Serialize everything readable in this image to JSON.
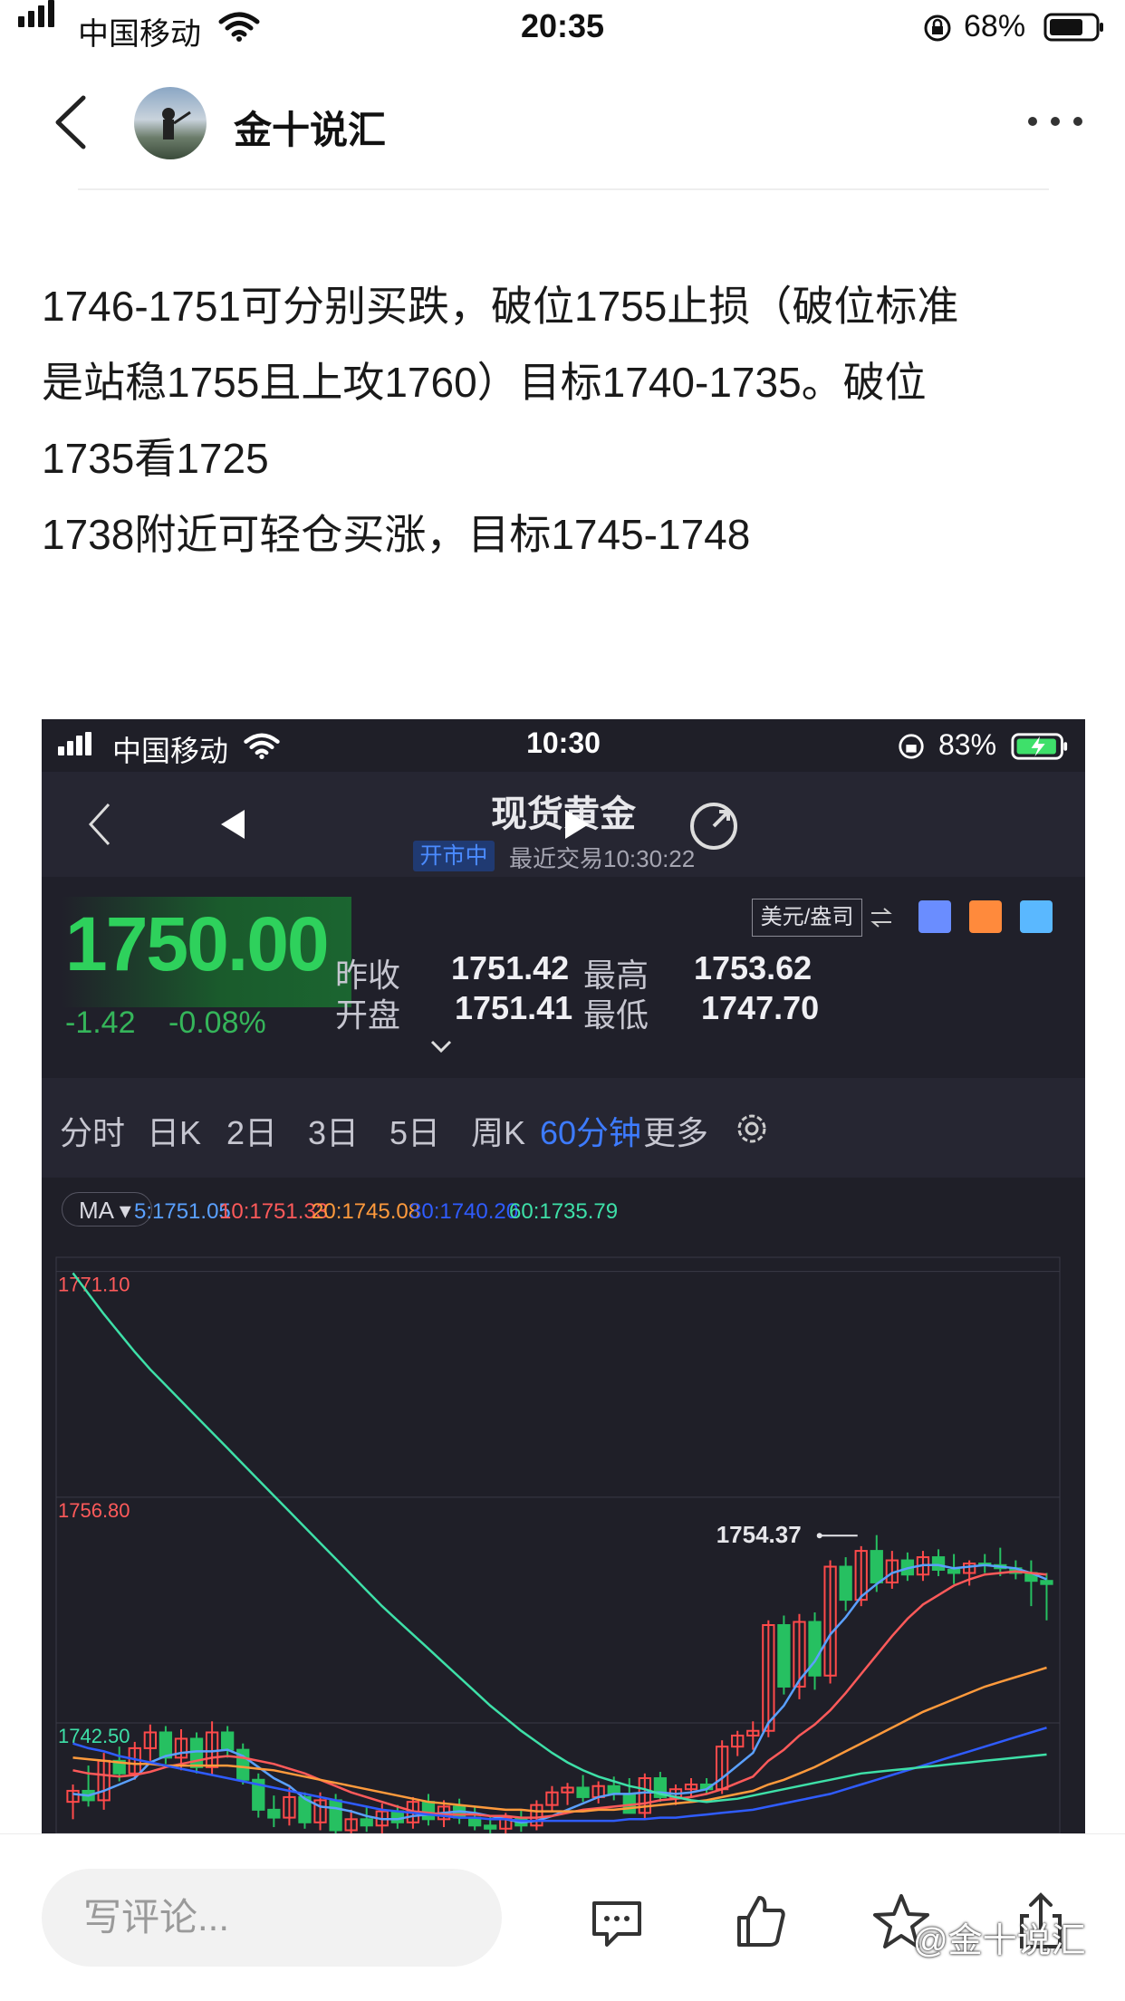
{
  "status_bar": {
    "carrier": "中国移动",
    "time": "20:35",
    "battery": "68%"
  },
  "header": {
    "author": "金十说汇"
  },
  "post": {
    "lines": [
      "1746-1751可分别买跌，破位1755止损（破位标准",
      "是站稳1755且上攻1760）目标1740-1735。破位",
      "1735看1725",
      "1738附近可轻仓买涨，目标1745-1748"
    ]
  },
  "screenshot": {
    "status_bar": {
      "carrier": "中国移动",
      "time": "10:30",
      "battery": "83%"
    },
    "nav": {
      "title": "现货黄金",
      "status_badge": "开市中",
      "recent_trade": "最近交易10:30:22"
    },
    "quote": {
      "price": "1750.00",
      "change": "-1.42",
      "change_pct": "-0.08%",
      "unit_label": "美元/盎司",
      "prev_close_label": "昨收",
      "prev_close": "1751.42",
      "open_label": "开盘",
      "open": "1751.41",
      "high_label": "最高",
      "high": "1753.62",
      "low_label": "最低",
      "low": "1747.70"
    },
    "tabs": [
      "分时",
      "日K",
      "2日",
      "3日",
      "5日",
      "周K",
      "60分钟",
      "更多"
    ],
    "active_tab": "60分钟",
    "ma_bar": {
      "button": "MA",
      "values": [
        {
          "label": "5:1751.05",
          "color": "#5aa0ff"
        },
        {
          "label": "10:1751.33",
          "color": "#ff5a5a"
        },
        {
          "label": "20:1745.08",
          "color": "#ff9a3c"
        },
        {
          "label": "30:1740.20",
          "color": "#2f5cff"
        },
        {
          "label": "60:1735.79",
          "color": "#3ee0a8"
        }
      ]
    },
    "colors": {
      "up": "#ff4a4a",
      "down": "#26c061",
      "accent": "#3d7bff"
    }
  },
  "chart_data": {
    "type": "candlestick",
    "y_tick_labels": [
      "1771.10",
      "1756.80",
      "1742.50"
    ],
    "ylim": [
      1735.5,
      1772.0
    ],
    "annotation": {
      "label": "1754.37",
      "value": 1754.37
    },
    "candles": [
      [
        1737.5,
        1738.6,
        1736.4,
        1738.2
      ],
      [
        1738.2,
        1739.8,
        1737.2,
        1737.6
      ],
      [
        1737.6,
        1740.6,
        1737.0,
        1740.1
      ],
      [
        1740.1,
        1741.0,
        1738.8,
        1739.3
      ],
      [
        1739.3,
        1741.3,
        1738.9,
        1740.9
      ],
      [
        1740.9,
        1742.4,
        1740.1,
        1741.9
      ],
      [
        1741.9,
        1742.3,
        1739.9,
        1740.3
      ],
      [
        1740.3,
        1742.1,
        1739.5,
        1741.5
      ],
      [
        1741.5,
        1741.9,
        1739.3,
        1739.7
      ],
      [
        1739.7,
        1742.6,
        1739.2,
        1741.9
      ],
      [
        1741.9,
        1742.3,
        1740.3,
        1740.8
      ],
      [
        1740.8,
        1741.2,
        1738.6,
        1738.9
      ],
      [
        1738.9,
        1739.3,
        1736.5,
        1737.0
      ],
      [
        1737.0,
        1737.9,
        1735.9,
        1736.5
      ],
      [
        1736.5,
        1738.4,
        1736.0,
        1737.8
      ],
      [
        1737.8,
        1738.1,
        1735.8,
        1736.2
      ],
      [
        1736.2,
        1738.1,
        1735.7,
        1737.6
      ],
      [
        1737.6,
        1738.0,
        1735.2,
        1735.7
      ],
      [
        1735.7,
        1737.0,
        1735.2,
        1736.4
      ],
      [
        1736.4,
        1737.2,
        1735.6,
        1736.0
      ],
      [
        1736.0,
        1737.4,
        1735.5,
        1736.9
      ],
      [
        1736.9,
        1737.3,
        1735.8,
        1736.2
      ],
      [
        1736.2,
        1737.8,
        1735.8,
        1737.5
      ],
      [
        1737.5,
        1738.0,
        1736.0,
        1736.4
      ],
      [
        1736.4,
        1737.6,
        1735.9,
        1737.2
      ],
      [
        1737.2,
        1737.7,
        1736.1,
        1736.5
      ],
      [
        1736.5,
        1737.2,
        1735.7,
        1736.0
      ],
      [
        1736.0,
        1736.6,
        1735.4,
        1735.8
      ],
      [
        1735.8,
        1736.8,
        1735.4,
        1736.5
      ],
      [
        1736.5,
        1737.0,
        1735.6,
        1736.0
      ],
      [
        1736.0,
        1737.6,
        1735.7,
        1737.3
      ],
      [
        1737.3,
        1738.5,
        1736.9,
        1738.1
      ],
      [
        1738.1,
        1738.7,
        1737.3,
        1738.4
      ],
      [
        1738.4,
        1739.2,
        1737.5,
        1737.8
      ],
      [
        1737.8,
        1738.8,
        1737.4,
        1738.5
      ],
      [
        1738.5,
        1739.1,
        1737.6,
        1738.0
      ],
      [
        1738.0,
        1739.0,
        1737.2,
        1736.8
      ],
      [
        1736.8,
        1739.3,
        1736.4,
        1739.0
      ],
      [
        1739.0,
        1739.4,
        1737.5,
        1737.8
      ],
      [
        1737.8,
        1738.6,
        1737.3,
        1738.3
      ],
      [
        1738.3,
        1739.0,
        1737.8,
        1738.6
      ],
      [
        1738.6,
        1739.0,
        1738.0,
        1738.3
      ],
      [
        1738.3,
        1741.4,
        1738.0,
        1741.0
      ],
      [
        1741.0,
        1742.0,
        1740.4,
        1741.7
      ],
      [
        1741.7,
        1742.6,
        1740.8,
        1742.0
      ],
      [
        1742.0,
        1749.0,
        1741.6,
        1748.7
      ],
      [
        1748.7,
        1749.3,
        1744.3,
        1744.8
      ],
      [
        1744.8,
        1749.4,
        1744.0,
        1748.9
      ],
      [
        1748.9,
        1749.5,
        1744.6,
        1745.5
      ],
      [
        1745.5,
        1752.8,
        1745.0,
        1752.4
      ],
      [
        1752.4,
        1753.0,
        1749.6,
        1750.3
      ],
      [
        1750.3,
        1753.7,
        1749.9,
        1753.4
      ],
      [
        1753.4,
        1754.4,
        1750.8,
        1751.4
      ],
      [
        1751.4,
        1753.4,
        1751.0,
        1752.8
      ],
      [
        1752.8,
        1753.3,
        1751.5,
        1751.9
      ],
      [
        1751.9,
        1753.4,
        1751.5,
        1753.0
      ],
      [
        1753.0,
        1753.5,
        1751.8,
        1752.2
      ],
      [
        1752.2,
        1753.2,
        1751.3,
        1752.0
      ],
      [
        1752.0,
        1752.8,
        1751.2,
        1752.6
      ],
      [
        1752.6,
        1753.2,
        1752.0,
        1752.5
      ],
      [
        1752.5,
        1753.6,
        1751.8,
        1752.3
      ],
      [
        1752.3,
        1752.8,
        1751.6,
        1752.0
      ],
      [
        1752.0,
        1752.8,
        1749.9,
        1751.5
      ],
      [
        1751.5,
        1752.0,
        1749.0,
        1751.3
      ]
    ],
    "ma_lines": [
      {
        "name": "5",
        "color": "#5aa0ff",
        "values": [
          1738.0,
          1737.9,
          1738.2,
          1738.6,
          1739.0,
          1740.0,
          1740.4,
          1740.6,
          1740.7,
          1740.7,
          1740.8,
          1740.4,
          1739.7,
          1739.0,
          1738.5,
          1737.7,
          1737.2,
          1737.1,
          1736.9,
          1736.6,
          1736.4,
          1736.4,
          1736.6,
          1736.7,
          1736.8,
          1736.9,
          1736.8,
          1736.6,
          1736.4,
          1736.2,
          1736.3,
          1736.6,
          1737.0,
          1737.4,
          1737.8,
          1738.0,
          1738.0,
          1738.1,
          1738.1,
          1738.0,
          1738.1,
          1738.3,
          1739.0,
          1739.8,
          1740.6,
          1742.5,
          1743.6,
          1745.2,
          1746.4,
          1748.1,
          1749.2,
          1750.5,
          1751.3,
          1752.0,
          1752.3,
          1752.5,
          1752.5,
          1752.3,
          1752.4,
          1752.5,
          1752.4,
          1752.3,
          1752.0,
          1751.6
        ]
      },
      {
        "name": "10",
        "color": "#ff5a5a",
        "values": [
          1739.5,
          1739.3,
          1739.2,
          1739.1,
          1739.2,
          1739.4,
          1739.7,
          1739.9,
          1740.1,
          1740.3,
          1740.4,
          1740.3,
          1740.1,
          1739.9,
          1739.6,
          1739.3,
          1738.9,
          1738.5,
          1738.1,
          1737.8,
          1737.5,
          1737.2,
          1736.9,
          1736.8,
          1736.7,
          1736.7,
          1736.7,
          1736.6,
          1736.6,
          1736.5,
          1736.5,
          1736.6,
          1736.8,
          1737.0,
          1737.1,
          1737.2,
          1737.3,
          1737.4,
          1737.6,
          1737.7,
          1737.8,
          1738.0,
          1738.3,
          1738.7,
          1739.1,
          1740.1,
          1740.8,
          1741.7,
          1742.4,
          1743.3,
          1744.4,
          1745.6,
          1746.8,
          1748.0,
          1749.1,
          1750.0,
          1750.6,
          1751.2,
          1751.6,
          1751.9,
          1752.0,
          1752.1,
          1752.0,
          1751.9
        ]
      },
      {
        "name": "20",
        "color": "#ff9a3c",
        "values": [
          1740.3,
          1740.2,
          1740.1,
          1740.0,
          1739.9,
          1739.9,
          1739.8,
          1739.8,
          1739.8,
          1739.8,
          1739.8,
          1739.7,
          1739.6,
          1739.5,
          1739.3,
          1739.1,
          1738.9,
          1738.7,
          1738.5,
          1738.3,
          1738.1,
          1737.9,
          1737.7,
          1737.5,
          1737.4,
          1737.3,
          1737.2,
          1737.1,
          1737.0,
          1737.0,
          1736.9,
          1736.9,
          1736.9,
          1736.9,
          1737.0,
          1737.0,
          1737.1,
          1737.2,
          1737.3,
          1737.4,
          1737.5,
          1737.6,
          1737.8,
          1738.0,
          1738.2,
          1738.6,
          1738.9,
          1739.3,
          1739.7,
          1740.2,
          1740.7,
          1741.2,
          1741.7,
          1742.2,
          1742.7,
          1743.2,
          1743.6,
          1744.0,
          1744.4,
          1744.8,
          1745.1,
          1745.4,
          1745.7,
          1746.0
        ]
      },
      {
        "name": "30",
        "color": "#2f5cff",
        "values": [
          1741.2,
          1740.9,
          1740.7,
          1740.4,
          1740.2,
          1740.0,
          1739.8,
          1739.6,
          1739.4,
          1739.2,
          1739.0,
          1738.8,
          1738.6,
          1738.4,
          1738.2,
          1738.0,
          1737.8,
          1737.6,
          1737.4,
          1737.2,
          1737.0,
          1736.9,
          1736.8,
          1736.7,
          1736.6,
          1736.5,
          1736.5,
          1736.4,
          1736.4,
          1736.3,
          1736.3,
          1736.3,
          1736.3,
          1736.3,
          1736.3,
          1736.3,
          1736.4,
          1736.4,
          1736.5,
          1736.5,
          1736.6,
          1736.7,
          1736.8,
          1736.9,
          1737.0,
          1737.2,
          1737.4,
          1737.6,
          1737.8,
          1738.0,
          1738.3,
          1738.6,
          1738.9,
          1739.2,
          1739.5,
          1739.8,
          1740.1,
          1740.4,
          1740.7,
          1741.0,
          1741.3,
          1741.6,
          1741.9,
          1742.2
        ]
      },
      {
        "name": "60",
        "color": "#3ee0a8",
        "values": [
          1771.0,
          1769.7,
          1768.4,
          1767.2,
          1766.0,
          1764.9,
          1763.9,
          1762.9,
          1761.9,
          1760.9,
          1759.9,
          1758.9,
          1757.9,
          1756.9,
          1755.9,
          1754.9,
          1753.9,
          1752.9,
          1751.9,
          1750.9,
          1749.9,
          1749.0,
          1748.1,
          1747.2,
          1746.3,
          1745.4,
          1744.5,
          1743.6,
          1742.8,
          1742.0,
          1741.3,
          1740.6,
          1740.0,
          1739.5,
          1739.1,
          1738.8,
          1738.5,
          1738.3,
          1738.0,
          1737.8,
          1737.6,
          1737.5,
          1737.6,
          1737.7,
          1737.9,
          1738.1,
          1738.3,
          1738.5,
          1738.7,
          1738.9,
          1739.1,
          1739.3,
          1739.4,
          1739.5,
          1739.6,
          1739.7,
          1739.8,
          1739.9,
          1740.0,
          1740.1,
          1740.2,
          1740.3,
          1740.4,
          1740.5
        ]
      }
    ]
  },
  "bottom": {
    "comment_placeholder": "写评论...",
    "watermark": "@金十说汇"
  }
}
